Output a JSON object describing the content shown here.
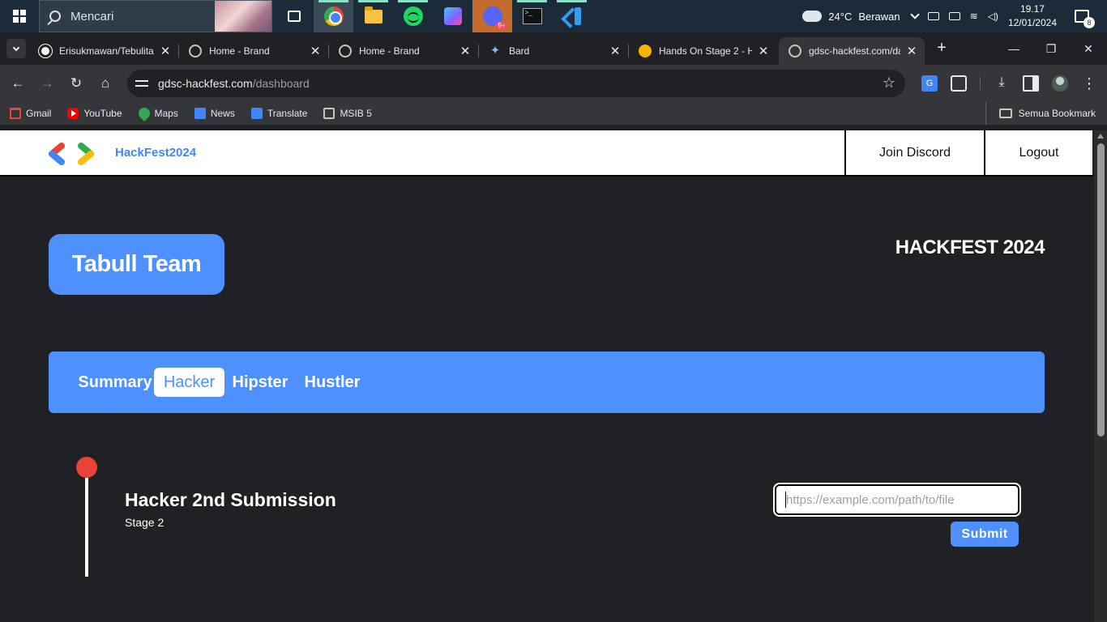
{
  "taskbar": {
    "search_placeholder": "Mencari",
    "apps": [
      "task-view",
      "chrome",
      "file-explorer",
      "spotify",
      "figma",
      "discord",
      "terminal",
      "vscode"
    ],
    "discord_badge": "9+",
    "weather": {
      "temp": "24°C",
      "condition": "Berawan"
    },
    "clock": {
      "time": "19.17",
      "date": "12/01/2024"
    },
    "notification_count": "8"
  },
  "tabs": [
    {
      "title": "Erisukmawan/Tebulitas",
      "icon": "github-icon"
    },
    {
      "title": "Home - Brand",
      "icon": "globe-icon"
    },
    {
      "title": "Home - Brand",
      "icon": "globe-icon"
    },
    {
      "title": "Bard",
      "icon": "bard-icon"
    },
    {
      "title": "Hands On Stage 2 - H",
      "icon": "slides-icon"
    },
    {
      "title": "gdsc-hackfest.com/da",
      "icon": "globe-icon",
      "active": true
    }
  ],
  "address": {
    "host": "gdsc-hackfest.com",
    "path": "/dashboard"
  },
  "bookmarks": [
    {
      "label": "Gmail",
      "icon": "gmail-icon"
    },
    {
      "label": "YouTube",
      "icon": "youtube-icon"
    },
    {
      "label": "Maps",
      "icon": "maps-icon"
    },
    {
      "label": "News",
      "icon": "news-icon"
    },
    {
      "label": "Translate",
      "icon": "translate-icon"
    },
    {
      "label": "MSIB 5",
      "icon": "folder-icon"
    }
  ],
  "bookmarks_all": "Semua Bookmark",
  "page": {
    "brand": "HackFest2024",
    "nav": {
      "discord": "Join Discord",
      "logout": "Logout"
    },
    "team_name": "Tabull Team",
    "event_title": "HACKFEST 2024",
    "tabs": [
      "Summary",
      "Hacker",
      "Hipster",
      "Hustler"
    ],
    "selected_tab": "Hacker",
    "submission": {
      "title": "Hacker 2nd Submission",
      "stage": "Stage 2",
      "url_placeholder": "https://example.com/path/to/file",
      "url_value": "",
      "submit_label": "Submit"
    }
  },
  "colors": {
    "accent": "#4d90fe",
    "background": "#202124",
    "timeline_dot": "#ea4335"
  }
}
